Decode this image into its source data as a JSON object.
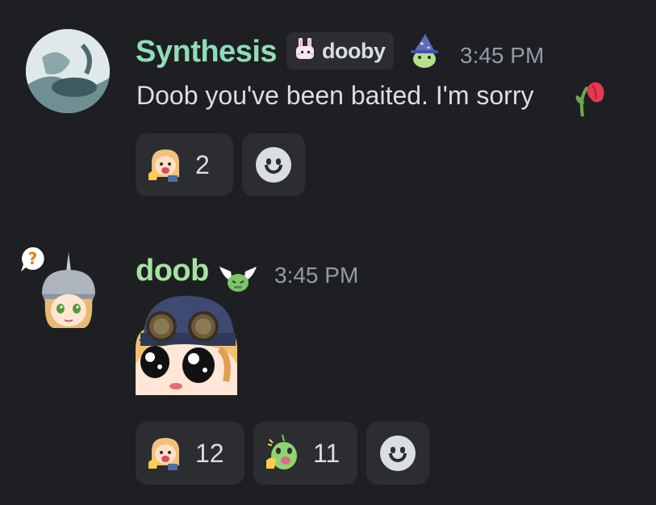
{
  "messages": [
    {
      "author": "Synthesis",
      "author_color": "#8fdcb7",
      "tag": {
        "label": "dooby",
        "icon": "bunny-icon"
      },
      "badge_icon": "wizard-frog-icon",
      "timestamp": "3:45 PM",
      "text": "Doob you've been baited. I'm sorry",
      "inline_emoji": "wilted-rose-icon",
      "reactions": [
        {
          "emoji": "pointing-anime-girl-emoji",
          "count": "2"
        }
      ],
      "add_reaction_icon": "smiley-add-reaction-icon"
    },
    {
      "author": "doob",
      "author_color": "#a6e3a1",
      "status_icon": "question-mark-icon",
      "badge_icon": "winged-frog-icon",
      "timestamp": "3:45 PM",
      "attachment": "goggles-anime-girl-sticker",
      "reactions": [
        {
          "emoji": "pointing-anime-girl-emoji",
          "count": "12"
        },
        {
          "emoji": "pointing-frog-emoji",
          "count": "11"
        }
      ],
      "add_reaction_icon": "smiley-add-reaction-icon"
    }
  ]
}
